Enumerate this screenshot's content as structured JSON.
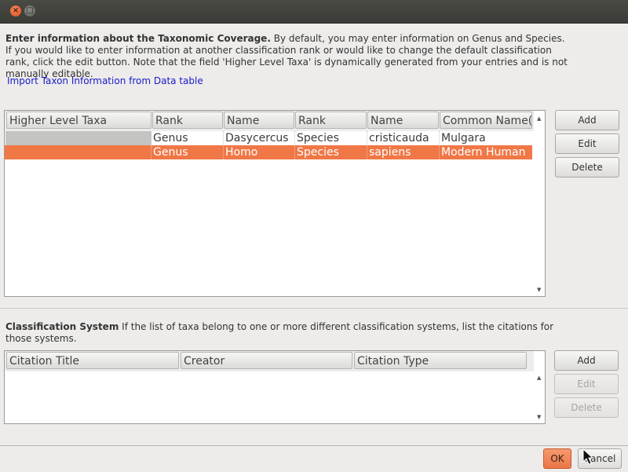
{
  "window": {
    "close_glyph": "×",
    "max_glyph": "□"
  },
  "intro": {
    "title": "Enter information about the Taxonomic Coverage.",
    "text": "By default, you may enter information on Genus and Species. If you would like to enter information at another classification rank or would like to change the default classification rank, click the edit button. Note that the field 'Higher Level Taxa' is dynamically generated from your entries and is not manually editable.",
    "import_link": "Import Taxon Information from Data table"
  },
  "taxa_table": {
    "columns": [
      "Higher Level Taxa",
      "Rank",
      "Name",
      "Rank",
      "Name",
      "Common Name(s)"
    ],
    "rows": [
      {
        "higher": "",
        "rank1": "Genus",
        "name1": "Dasycercus",
        "rank2": "Species",
        "name2": "cristicauda",
        "common": "Mulgara",
        "selected": false
      },
      {
        "higher": "",
        "rank1": "Genus",
        "name1": "Homo",
        "rank2": "Species",
        "name2": "sapiens",
        "common": "Modern Human",
        "selected": true
      }
    ],
    "buttons": {
      "add": "Add",
      "edit": "Edit",
      "delete": "Delete"
    }
  },
  "classification": {
    "title": "Classification System",
    "text": "If the list of taxa belong to one or more different classification systems, list the citations for those systems.",
    "columns": [
      "Citation Title",
      "Creator",
      "Citation Type"
    ],
    "buttons": {
      "add": "Add",
      "edit": "Edit",
      "delete": "Delete"
    }
  },
  "footer": {
    "ok": "OK",
    "cancel": "Cancel"
  },
  "colors": {
    "selection": "#f07746",
    "link": "#1a1ac8"
  }
}
